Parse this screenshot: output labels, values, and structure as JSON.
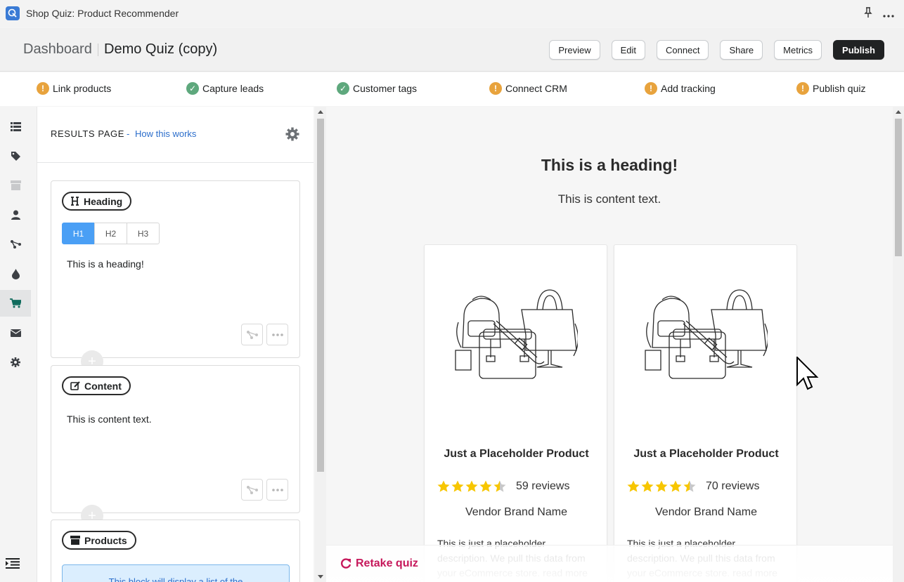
{
  "window": {
    "title": "Shop Quiz: Product Recommender"
  },
  "header": {
    "breadcrumb_root": "Dashboard",
    "quiz_name": "Demo Quiz (copy)",
    "buttons": {
      "preview": "Preview",
      "edit": "Edit",
      "connect": "Connect",
      "share": "Share",
      "metrics": "Metrics",
      "publish": "Publish"
    }
  },
  "checklist": [
    {
      "label": "Link products",
      "status": "warning"
    },
    {
      "label": "Capture leads",
      "status": "done"
    },
    {
      "label": "Customer tags",
      "status": "done"
    },
    {
      "label": "Connect CRM",
      "status": "warning"
    },
    {
      "label": "Add tracking",
      "status": "warning"
    },
    {
      "label": "Publish quiz",
      "status": "warning"
    }
  ],
  "sidebar": {
    "items": [
      {
        "icon": "list-icon"
      },
      {
        "icon": "tag-icon"
      },
      {
        "icon": "box-icon"
      },
      {
        "icon": "user-icon"
      },
      {
        "icon": "branch-icon"
      },
      {
        "icon": "drop-icon"
      },
      {
        "icon": "cart-icon",
        "active": true
      },
      {
        "icon": "mail-icon"
      },
      {
        "icon": "gear-icon"
      }
    ],
    "bottom_icon": "collapse-menu-icon"
  },
  "panel": {
    "title": "RESULTS PAGE",
    "separator": "-",
    "help_link": "How this works",
    "blocks": {
      "heading": {
        "label": "Heading",
        "levels": [
          "H1",
          "H2",
          "H3"
        ],
        "selected_level": "H1",
        "text": "This is a heading!"
      },
      "content": {
        "label": "Content",
        "text": "This is content text."
      },
      "products": {
        "label": "Products",
        "notice": "This block will display a list of the"
      }
    },
    "add_symbol": "+"
  },
  "preview": {
    "heading": "This is a heading!",
    "content": "This is content text.",
    "products": [
      {
        "name": "Just a Placeholder Product",
        "rating": 4.5,
        "reviews": "59 reviews",
        "vendor": "Vendor Brand Name",
        "description": "This is just a placeholder description. We pull this data from your eCommerce store. read more"
      },
      {
        "name": "Just a Placeholder Product",
        "rating": 4.5,
        "reviews": "70 reviews",
        "vendor": "Vendor Brand Name",
        "description": "This is just a placeholder description. We pull this data from your eCommerce store. read more"
      }
    ],
    "retake": "Retake quiz"
  },
  "colors": {
    "publish_bg": "#202223",
    "warning": "#e8a33d",
    "success": "#5ea87d",
    "link": "#2c6ecb",
    "level_active": "#4a9ff5",
    "star": "#f7c600",
    "retake": "#c6185b",
    "active_nav": "#0f6b5c"
  }
}
